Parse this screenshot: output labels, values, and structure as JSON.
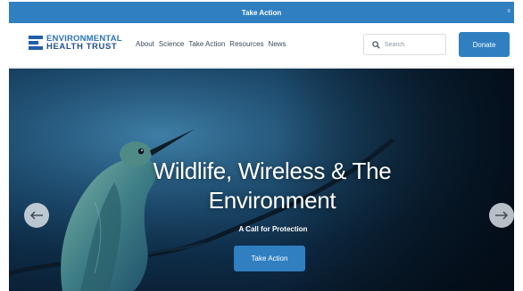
{
  "top_bar": {
    "label": "Take Action",
    "close_glyph": "x"
  },
  "logo": {
    "line1": "ENVIRONMENTAL",
    "line2": "HEALTH TRUST"
  },
  "nav": {
    "items": [
      {
        "label": "About"
      },
      {
        "label": "Science"
      },
      {
        "label": "Take Action"
      },
      {
        "label": "Resources"
      },
      {
        "label": "News"
      }
    ]
  },
  "search": {
    "placeholder": "Search",
    "icon": "search-icon"
  },
  "donate": {
    "label": "Donate"
  },
  "hero": {
    "title": "Wildlife, Wireless & The Environment",
    "subtitle": "A Call for Protection",
    "cta_label": "Take Action",
    "prev_icon": "arrow-left-icon",
    "next_icon": "arrow-right-icon"
  },
  "colors": {
    "brand_blue": "#2f7fc1",
    "logo_dark": "#1f4f8a",
    "hero_dark": "#0e2c47"
  }
}
